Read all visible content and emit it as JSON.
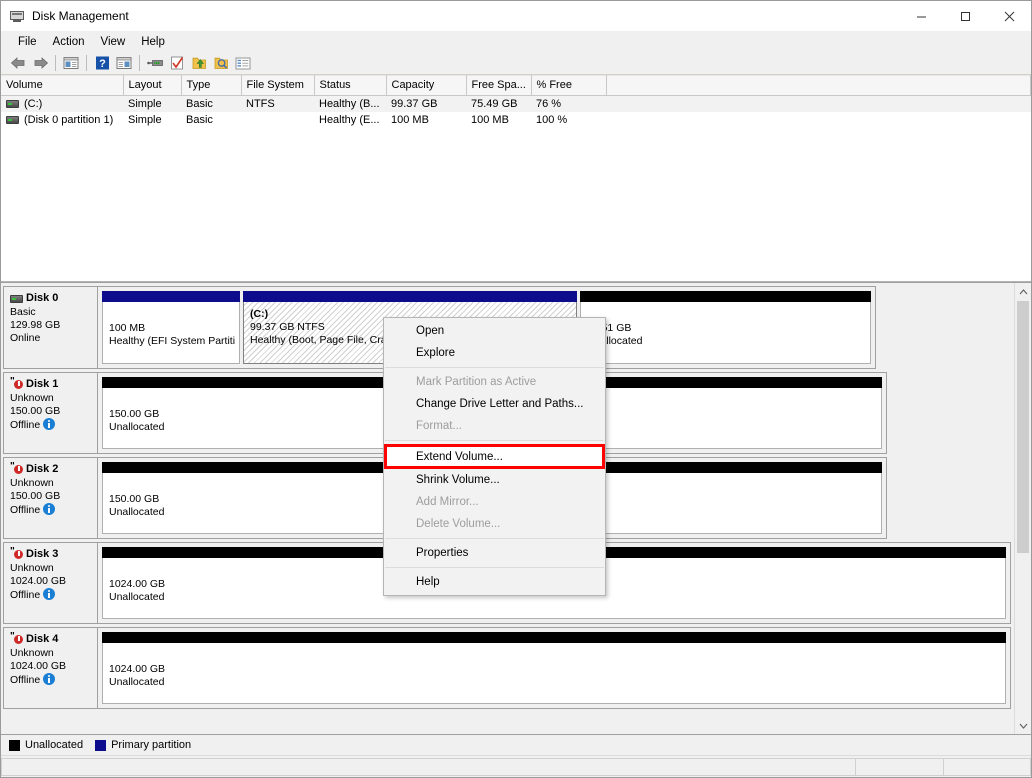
{
  "window": {
    "title": "Disk Management",
    "icon": "disk-management-icon",
    "buttons": {
      "minimize": "minimize-icon",
      "maximize": "maximize-icon",
      "close": "close-icon"
    }
  },
  "menubar": {
    "items": [
      {
        "label": "File",
        "name": "menu-file"
      },
      {
        "label": "Action",
        "name": "menu-action"
      },
      {
        "label": "View",
        "name": "menu-view"
      },
      {
        "label": "Help",
        "name": "menu-help"
      }
    ]
  },
  "toolbar": {
    "items": [
      {
        "name": "back-icon"
      },
      {
        "name": "forward-icon"
      },
      {
        "name": "separator"
      },
      {
        "name": "show-hide-console-tree-icon"
      },
      {
        "name": "separator"
      },
      {
        "name": "help-icon"
      },
      {
        "name": "show-hide-action-pane-icon"
      },
      {
        "name": "separator"
      },
      {
        "name": "rescan-disks-icon"
      },
      {
        "name": "refresh-icon"
      },
      {
        "name": "create-vhd-icon"
      },
      {
        "name": "attach-vhd-icon"
      },
      {
        "name": "properties-icon"
      }
    ]
  },
  "volume_list": {
    "columns": [
      "Volume",
      "Layout",
      "Type",
      "File System",
      "Status",
      "Capacity",
      "Free Spa...",
      "% Free",
      ""
    ],
    "rows": [
      {
        "volume": "(C:)",
        "layout": "Simple",
        "type": "Basic",
        "file_system": "NTFS",
        "status": "Healthy (B...",
        "capacity": "99.37 GB",
        "free_space": "75.49 GB",
        "percent_free": "76 %",
        "selected": true
      },
      {
        "volume": "(Disk 0 partition 1)",
        "layout": "Simple",
        "type": "Basic",
        "file_system": "",
        "status": "Healthy (E...",
        "capacity": "100 MB",
        "free_space": "100 MB",
        "percent_free": "100 %",
        "selected": false
      }
    ]
  },
  "disks": [
    {
      "name": "Disk 0",
      "type": "Basic",
      "size": "129.98 GB",
      "state": "Online",
      "has_error_icon": false,
      "has_info_icon": false,
      "partitions": [
        {
          "label": "",
          "line1": "100 MB",
          "line2": "Healthy (EFI System Partiti",
          "bar": "primary",
          "selected": false
        },
        {
          "label": "(C:)",
          "line1": "99.37 GB NTFS",
          "line2": "Healthy (Boot, Page File, Crash",
          "bar": "primary",
          "selected": true
        },
        {
          "label": "",
          "line1": "30.51 GB",
          "line2": "Unallocated",
          "bar": "unalloc",
          "selected": false
        }
      ]
    },
    {
      "name": "Disk 1",
      "type": "Unknown",
      "size": "150.00 GB",
      "state": "Offline",
      "has_error_icon": true,
      "has_info_icon": true,
      "partitions": [
        {
          "label": "",
          "line1": "150.00 GB",
          "line2": "Unallocated",
          "bar": "unalloc",
          "selected": false
        }
      ]
    },
    {
      "name": "Disk 2",
      "type": "Unknown",
      "size": "150.00 GB",
      "state": "Offline",
      "has_error_icon": true,
      "has_info_icon": true,
      "partitions": [
        {
          "label": "",
          "line1": "150.00 GB",
          "line2": "Unallocated",
          "bar": "unalloc",
          "selected": false
        }
      ]
    },
    {
      "name": "Disk 3",
      "type": "Unknown",
      "size": "1024.00 GB",
      "state": "Offline",
      "has_error_icon": true,
      "has_info_icon": true,
      "partitions": [
        {
          "label": "",
          "line1": "1024.00 GB",
          "line2": "Unallocated",
          "bar": "unalloc",
          "selected": false
        }
      ]
    },
    {
      "name": "Disk 4",
      "type": "Unknown",
      "size": "1024.00 GB",
      "state": "Offline",
      "has_error_icon": true,
      "has_info_icon": true,
      "partitions": [
        {
          "label": "",
          "line1": "1024.00 GB",
          "line2": "Unallocated",
          "bar": "unalloc",
          "selected": false
        }
      ]
    }
  ],
  "legend": {
    "items": [
      {
        "label": "Unallocated",
        "color": "#000000",
        "name": "legend-unallocated"
      },
      {
        "label": "Primary partition",
        "color": "#0c0c8c",
        "name": "legend-primary-partition"
      }
    ]
  },
  "context_menu": {
    "items": [
      {
        "label": "Open",
        "disabled": false,
        "highlighted": false
      },
      {
        "label": "Explore",
        "disabled": false,
        "highlighted": false
      },
      {
        "separator": true
      },
      {
        "label": "Mark Partition as Active",
        "disabled": true,
        "highlighted": false
      },
      {
        "label": "Change Drive Letter and Paths...",
        "disabled": false,
        "highlighted": false
      },
      {
        "label": "Format...",
        "disabled": true,
        "highlighted": false
      },
      {
        "separator": true
      },
      {
        "label": "Extend Volume...",
        "disabled": false,
        "highlighted": true
      },
      {
        "label": "Shrink Volume...",
        "disabled": false,
        "highlighted": false
      },
      {
        "label": "Add Mirror...",
        "disabled": true,
        "highlighted": false
      },
      {
        "label": "Delete Volume...",
        "disabled": true,
        "highlighted": false
      },
      {
        "separator": true
      },
      {
        "label": "Properties",
        "disabled": false,
        "highlighted": false
      },
      {
        "separator": true
      },
      {
        "label": "Help",
        "disabled": false,
        "highlighted": false
      }
    ],
    "highlight_color": "#ff0000"
  },
  "colors": {
    "primary_partition": "#0c0c8c",
    "unallocated": "#000000",
    "highlight_box": "#ff0000",
    "window_bg": "#f0f0f0"
  }
}
